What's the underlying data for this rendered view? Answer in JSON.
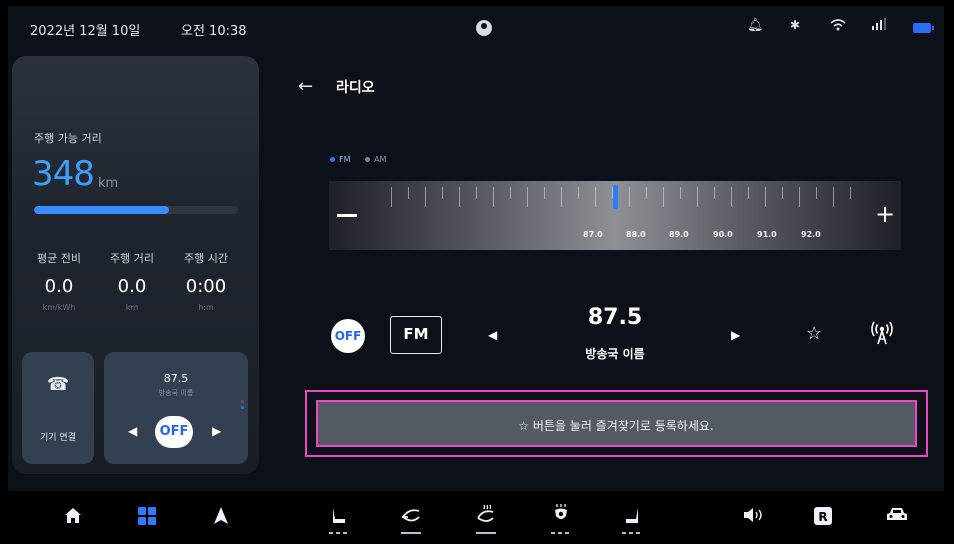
{
  "status_bar": {
    "date": "2022년 12월 10일",
    "time": "오전 10:38",
    "icons": [
      "profile-icon",
      "bell-icon",
      "bluetooth-icon",
      "wifi-icon",
      "signal-icon",
      "battery-icon"
    ]
  },
  "left_panel": {
    "range_label": "주행 가능 거리",
    "range_value": "348",
    "range_unit": "km",
    "range_progress": 0.66,
    "stats": [
      {
        "label": "평균 전비",
        "value": "0.0",
        "unit": "km/kWh"
      },
      {
        "label": "주행 거리",
        "value": "0.0",
        "unit": "km"
      },
      {
        "label": "주행 시간",
        "value": "0:00",
        "unit": "h:m"
      }
    ],
    "connect_card": {
      "label": "기기 연결",
      "icon": "phone-icon"
    },
    "radio_card": {
      "frequency": "87.5",
      "station": "방송국 이름",
      "off_label": "OFF"
    }
  },
  "radio": {
    "title": "라디오",
    "bands": [
      "FM",
      "AM"
    ],
    "selected_band": "FM",
    "tuner_labels": [
      "87.0",
      "88.0",
      "89.0",
      "90.0",
      "91.0",
      "92.0"
    ],
    "current_frequency": "87.5",
    "station_name": "방송국 이름",
    "off_label": "OFF",
    "band_button": "FM",
    "hint": "☆ 버튼을 눌러 즐겨찾기로 등록하세요."
  },
  "dock": {
    "items": [
      "home-icon",
      "apps-grid-icon",
      "navigation-icon",
      "driver-seat-icon",
      "fan-icon",
      "rear-defrost-icon",
      "seat-ventilation-icon",
      "passenger-seat-icon",
      "volume-icon",
      "gear-reverse-icon",
      "car-icon"
    ],
    "active": "apps-grid-icon",
    "reverse_label": "R"
  },
  "colors": {
    "accent": "#2f7bff",
    "range_value": "#3fa0ff",
    "highlight_frame": "#f044c8",
    "card": "#33404f"
  }
}
